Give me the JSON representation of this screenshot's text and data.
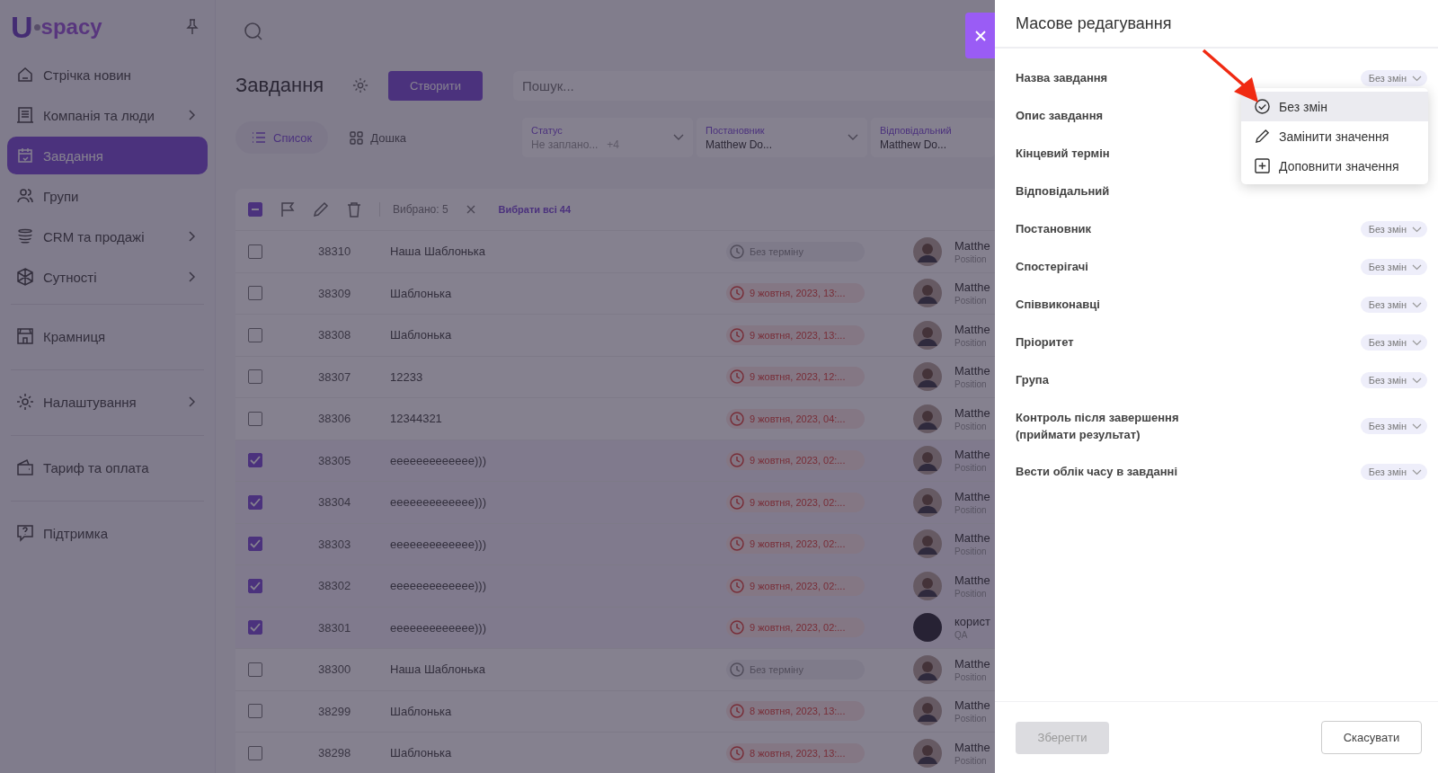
{
  "sidebar": {
    "logo": {
      "mark": "U",
      "name": "spacy"
    },
    "items": [
      {
        "label": "Стрічка новин",
        "selected": false,
        "expandable": false,
        "divider_before": false
      },
      {
        "label": "Компанія та люди",
        "selected": false,
        "expandable": true,
        "divider_before": false
      },
      {
        "label": "Завдання",
        "selected": true,
        "expandable": false,
        "divider_before": false
      },
      {
        "label": "Групи",
        "selected": false,
        "expandable": false,
        "divider_before": false
      },
      {
        "label": "CRM та продажі",
        "selected": false,
        "expandable": true,
        "divider_before": false
      },
      {
        "label": "Сутності",
        "selected": false,
        "expandable": true,
        "divider_before": false
      },
      {
        "label": "Крамниця",
        "selected": false,
        "expandable": false,
        "divider_before": true
      },
      {
        "label": "Налаштування",
        "selected": false,
        "expandable": true,
        "divider_before": true
      },
      {
        "label": "Тариф та оплата",
        "selected": false,
        "expandable": false,
        "divider_before": true
      },
      {
        "label": "Підтримка",
        "selected": false,
        "expandable": false,
        "divider_before": true
      }
    ]
  },
  "page": {
    "title": "Завдання",
    "create_button": "Створити",
    "search": {
      "placeholder": "Пошук..."
    },
    "view_tabs": [
      {
        "label": "Список",
        "selected": true
      },
      {
        "label": "Дошка",
        "selected": false
      }
    ],
    "filters": [
      {
        "label": "Статус",
        "value": "Не заплано...",
        "extra": "+4",
        "has_chevron": true
      },
      {
        "label": "Постановник",
        "value": "Matthew Do...",
        "has_chevron": true
      },
      {
        "label": "Відповідальний",
        "value": "Matthew Do...",
        "has_chevron": false
      }
    ]
  },
  "bulk_bar": {
    "indeterminate": true,
    "selected_count": "Вибрано: 5",
    "select_all": "Вибрати всі 44"
  },
  "rows": [
    {
      "id": "38310",
      "title": "Наша Шаблонька",
      "deadline": "Без терміну",
      "overdue": false,
      "assignee": "Matthe",
      "position": "Position",
      "checked": false
    },
    {
      "id": "38309",
      "title": "Шаблонька",
      "deadline": "9 жовтня, 2023, 13:...",
      "overdue": true,
      "assignee": "Matthe",
      "position": "Position",
      "checked": false
    },
    {
      "id": "38308",
      "title": "Шаблонька",
      "deadline": "9 жовтня, 2023, 13:...",
      "overdue": true,
      "assignee": "Matthe",
      "position": "Position",
      "checked": false
    },
    {
      "id": "38307",
      "title": "12233",
      "deadline": "9 жовтня, 2023, 12:...",
      "overdue": true,
      "assignee": "Matthe",
      "position": "Position",
      "checked": false
    },
    {
      "id": "38306",
      "title": "12344321",
      "deadline": "9 жовтня, 2023, 04:...",
      "overdue": true,
      "assignee": "Matthe",
      "position": "Position",
      "checked": false
    },
    {
      "id": "38305",
      "title": "eeeeeeeeeeeee)))",
      "deadline": "9 жовтня, 2023, 02:...",
      "overdue": true,
      "assignee": "Matthe",
      "position": "Position",
      "checked": true
    },
    {
      "id": "38304",
      "title": "eeeeeeeeeeeee)))",
      "deadline": "9 жовтня, 2023, 02:...",
      "overdue": true,
      "assignee": "Matthe",
      "position": "Position",
      "checked": true
    },
    {
      "id": "38303",
      "title": "eeeeeeeeeeeee)))",
      "deadline": "9 жовтня, 2023, 02:...",
      "overdue": true,
      "assignee": "Matthe",
      "position": "Position",
      "checked": true
    },
    {
      "id": "38302",
      "title": "eeeeeeeeeeeee)))",
      "deadline": "9 жовтня, 2023, 02:...",
      "overdue": true,
      "assignee": "Matthe",
      "position": "Position",
      "checked": true
    },
    {
      "id": "38301",
      "title": "eeeeeeeeeeeee)))",
      "deadline": "9 жовтня, 2023, 02:...",
      "overdue": true,
      "assignee": "корист",
      "position": "QA",
      "avatar": {
        "kind": "dark"
      },
      "checked": true
    },
    {
      "id": "38300",
      "title": "Наша Шаблонька",
      "deadline": "Без терміну",
      "overdue": false,
      "assignee": "Matthe",
      "position": "Position",
      "checked": false
    },
    {
      "id": "38299",
      "title": "Шаблонька",
      "deadline": "8 жовтня, 2023, 13:...",
      "overdue": true,
      "assignee": "Matthe",
      "position": "Position",
      "checked": false
    },
    {
      "id": "38298",
      "title": "Шаблонька",
      "deadline": "8 жовтня, 2023, 13:...",
      "overdue": true,
      "assignee": "Matthe",
      "position": "Position",
      "checked": false
    }
  ],
  "drawer": {
    "title": "Масове редагування",
    "fields": [
      {
        "label": "Назва завдання",
        "value": "Без змін"
      },
      {
        "label": "Опис завдання"
      },
      {
        "label": "Кінцевий термін"
      },
      {
        "label": "Відповідальний"
      },
      {
        "label": "Постановник",
        "value": "Без змін"
      },
      {
        "label": "Спостерігачі",
        "value": "Без змін"
      },
      {
        "label": "Співвиконавці",
        "value": "Без змін"
      },
      {
        "label": "Пріоритет",
        "value": "Без змін"
      },
      {
        "label": "Група",
        "value": "Без змін"
      },
      {
        "label": "Контроль після завершення (приймати результат)",
        "value": "Без змін"
      },
      {
        "label": "Вести облік часу в завданні",
        "value": "Без змін"
      }
    ],
    "menu": [
      {
        "label": "Без змін",
        "kind": "keep",
        "selected": true
      },
      {
        "label": "Замінити значення",
        "kind": "replace",
        "selected": false
      },
      {
        "label": "Доповнити значення",
        "kind": "append",
        "selected": false
      }
    ],
    "save_button": {
      "label": "Зберегти",
      "disabled": true
    },
    "cancel_button": "Скасувати"
  }
}
